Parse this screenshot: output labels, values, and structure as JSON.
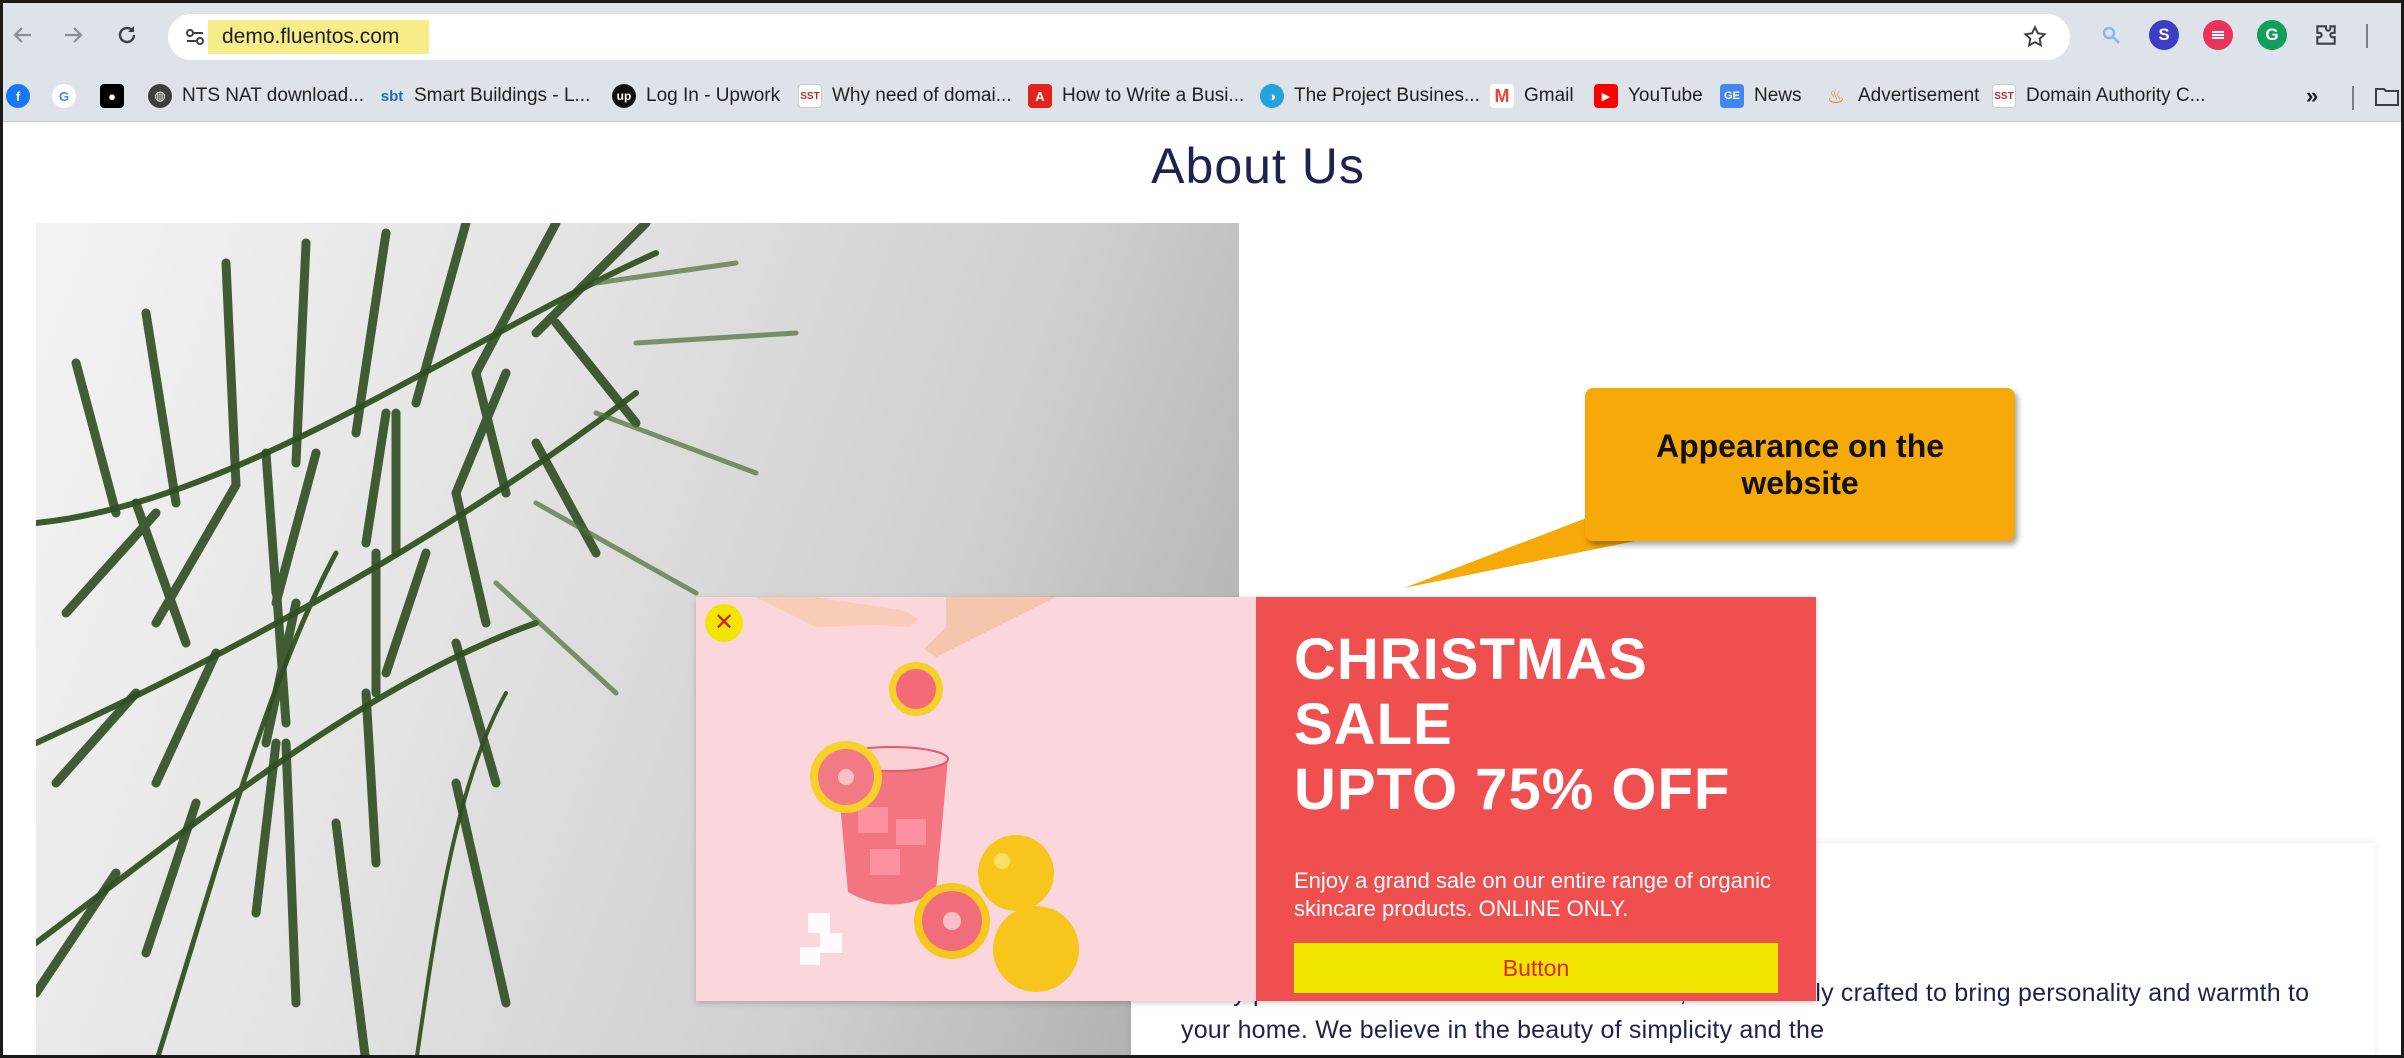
{
  "browser": {
    "url": "demo.fluentos.com",
    "bookmarks": [
      {
        "label": "NTS NAT download...",
        "icon": "globe-icon"
      },
      {
        "label": "Smart Buildings - L...",
        "icon": "smart-buildings-icon"
      },
      {
        "label": "Log In - Upwork",
        "icon": "upwork-icon"
      },
      {
        "label": "Why need of domai...",
        "icon": "sst-icon"
      },
      {
        "label": "How to Write a Busi...",
        "icon": "adobe-icon"
      },
      {
        "label": "The Project Busines...",
        "icon": "project-icon"
      },
      {
        "label": "Gmail",
        "icon": "gmail-icon"
      },
      {
        "label": "YouTube",
        "icon": "youtube-icon"
      },
      {
        "label": "News",
        "icon": "news-icon"
      },
      {
        "label": "Advertisement",
        "icon": "flame-icon"
      },
      {
        "label": "Domain Authority C...",
        "icon": "sst-icon"
      }
    ]
  },
  "page": {
    "title": "About Us",
    "about_text": "Every piece of our furniture is a labor of love, meticulously crafted to bring personality and warmth to your home. We believe in the beauty of simplicity and the"
  },
  "callout": {
    "text": "Appearance on the website"
  },
  "popup": {
    "headline_line1": "CHRISTMAS",
    "headline_line2": "SALE",
    "headline_line3": "UPTO 75% OFF",
    "subtext": "Enjoy a grand sale on our entire range of organic skincare products. ONLINE ONLY.",
    "button_label": "Button",
    "close_symbol": "✕"
  },
  "colors": {
    "popup_red": "#ef4f4f",
    "button_yellow": "#f0e600",
    "callout_orange": "#f6a908",
    "title_navy": "#1c2350"
  }
}
